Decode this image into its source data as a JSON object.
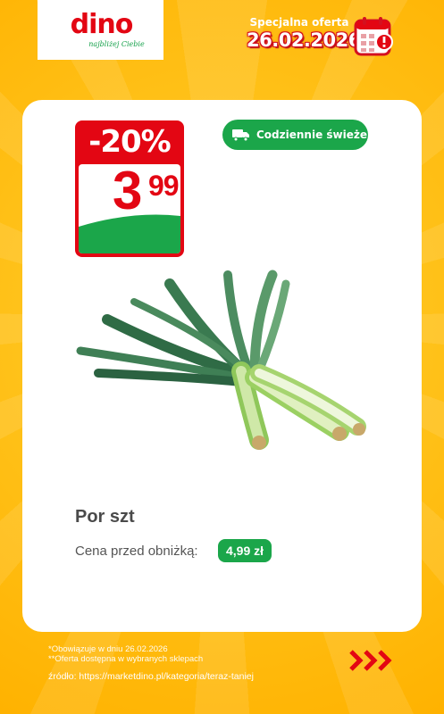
{
  "logo": {
    "wordmark": "dino",
    "tagline": "najbliżej Ciebie"
  },
  "header": {
    "offer_label": "Specjalna oferta",
    "offer_date": "26.02.2026",
    "calendar_icon": "calendar-alert-icon"
  },
  "badge": {
    "discount": "-20%",
    "price_main": "3",
    "price_cents": "99"
  },
  "fresh_tag": {
    "label": "Codziennie świeże",
    "icon": "truck-icon"
  },
  "product": {
    "name": "Por szt",
    "previous_price_label": "Cena przed obniżką:",
    "previous_price": "4,99 zł"
  },
  "footer": {
    "note1": "*Obowiązuje w dniu 26.02.2026",
    "note2": "**Oferta dostępna w wybranych sklepach",
    "source": "źródło: https://marketdino.pl/kategoria/teraz-taniej"
  },
  "colors": {
    "brand_red": "#e30613",
    "brand_green": "#1ba64a",
    "background": "#ffc21a"
  }
}
